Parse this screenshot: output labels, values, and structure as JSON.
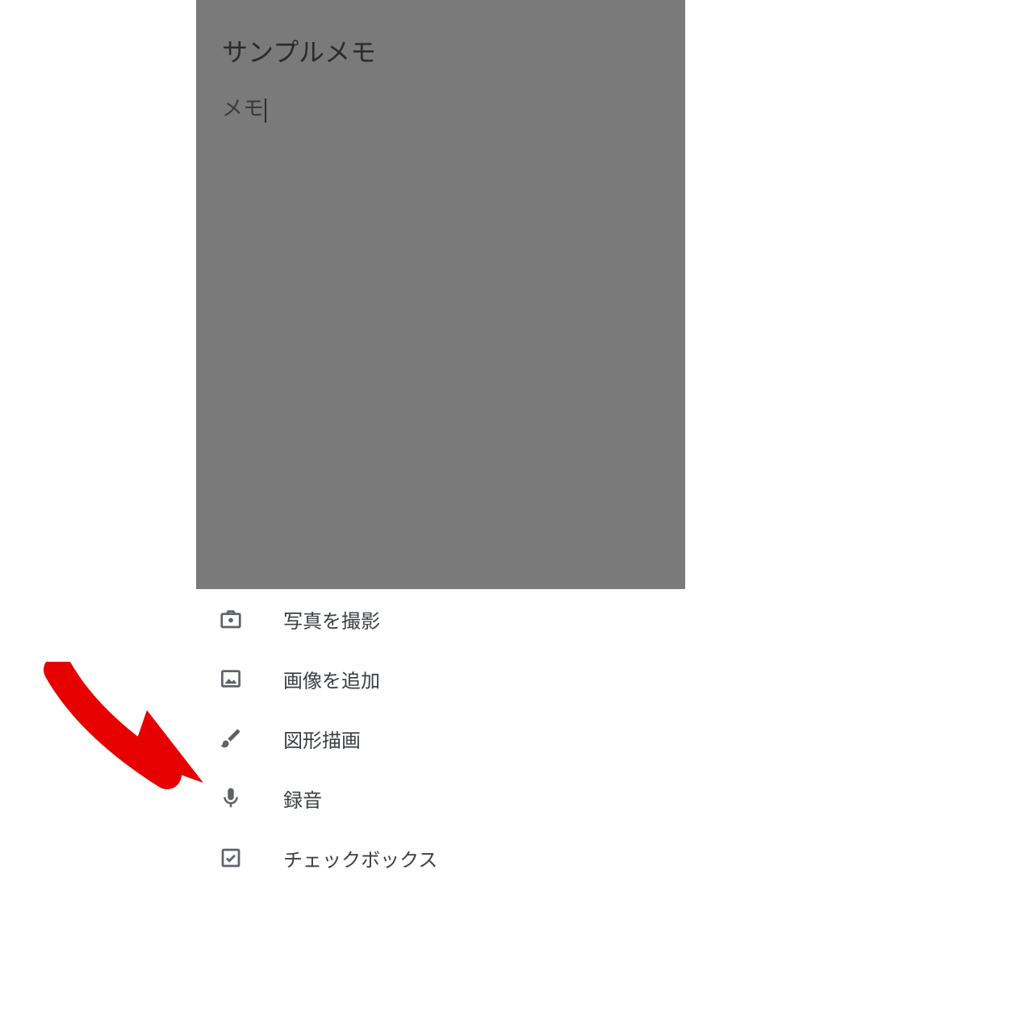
{
  "note": {
    "title": "サンプルメモ",
    "body": "メモ"
  },
  "menu": {
    "items": [
      {
        "icon": "camera",
        "label": "写真を撮影"
      },
      {
        "icon": "image",
        "label": "画像を追加"
      },
      {
        "icon": "brush",
        "label": "図形描画"
      },
      {
        "icon": "mic",
        "label": "録音"
      },
      {
        "icon": "checkbox",
        "label": "チェックボックス"
      }
    ]
  },
  "annotation": {
    "arrow_color": "#e60000"
  }
}
